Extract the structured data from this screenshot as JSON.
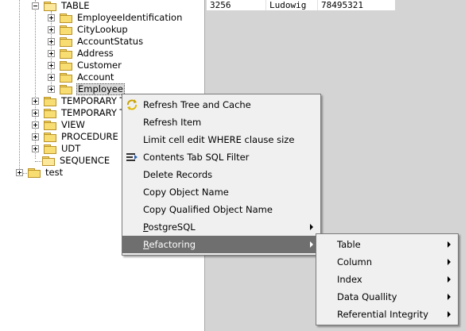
{
  "tree": {
    "table_group": "TABLE",
    "tables": [
      "EmployeeIdentification",
      "CityLookup",
      "AccountStatus",
      "Address",
      "Customer",
      "Account",
      "Employee"
    ],
    "temporary_1": "TEMPORARY T",
    "temporary_2": "TEMPORARY T",
    "view": "VIEW",
    "procedure": "PROCEDURE",
    "udt": "UDT",
    "sequence": "SEQUENCE",
    "test": "test"
  },
  "grid": {
    "row": [
      "3256",
      "Ludowig",
      "78495321"
    ]
  },
  "context_menu": {
    "items": [
      {
        "label": "Refresh Tree and Cache",
        "icon": "refresh-icon"
      },
      {
        "label": "Refresh Item"
      },
      {
        "label": "Limit cell edit WHERE clause size"
      },
      {
        "label": "Contents Tab SQL Filter",
        "icon": "filter-icon"
      },
      {
        "label": "Delete Records"
      },
      {
        "label": "Copy Object Name"
      },
      {
        "label": "Copy Qualified Object Name"
      },
      {
        "label_first": "P",
        "label_rest": "ostgreSQL"
      },
      {
        "label_first": "R",
        "label_rest": "efactoring"
      }
    ]
  },
  "submenu": {
    "items": [
      "Table",
      "Column",
      "Index",
      "Data Quallity",
      "Referential Integrity"
    ]
  },
  "colors": {
    "menu_bg": "#f0f0f0",
    "menu_active": "#6f6f6f",
    "folder": "#f8dd72",
    "grid_bg": "#d4d4d4"
  }
}
